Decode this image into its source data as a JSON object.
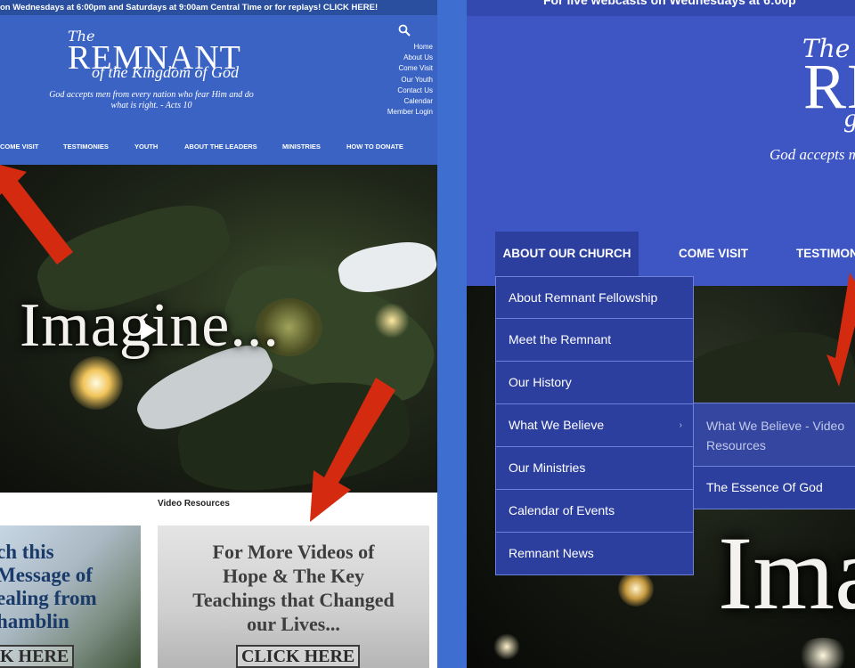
{
  "left": {
    "announcement": "on Wednesdays at 6:00pm and Saturdays at 9:00am Central Time or for replays! CLICK HERE!",
    "logo": {
      "the": "The",
      "name": "REMNANT",
      "sub": "of the Kingdom of God",
      "tagline_1": "God accepts men from every nation who fear Him and do",
      "tagline_2": "what is right.  - Acts 10"
    },
    "util_nav": [
      "Home",
      "About Us",
      "Come Visit",
      "Our Youth",
      "Contact Us",
      "Calendar",
      "Member Login"
    ],
    "main_nav": [
      "COME VISIT",
      "TESTIMONIES",
      "YOUTH",
      "ABOUT THE LEADERS",
      "MINISTRIES",
      "HOW TO DONATE"
    ],
    "hero_text": "Imagine...",
    "video_resources_label": "Video Resources",
    "card1": {
      "lines": [
        "ch this",
        "Message of",
        "ealing from",
        "hamblin"
      ],
      "button": "K HERE"
    },
    "card2": {
      "lines": [
        "For More Videos of",
        "Hope & The Key",
        "Teachings that Changed",
        "our Lives..."
      ],
      "button": "CLICK HERE"
    }
  },
  "right": {
    "announcement": "For live webcasts on Wednesdays at 6:00p",
    "logo": {
      "the": "The",
      "name": "RE",
      "sub": "g",
      "tagline": "God accepts m"
    },
    "main_nav": {
      "active": "ABOUT OUR CHURCH",
      "items": [
        "COME VISIT",
        "TESTIMON"
      ]
    },
    "dropdown": [
      {
        "label": "About Remnant Fellowship",
        "has_submenu": false
      },
      {
        "label": "Meet the Remnant",
        "has_submenu": false
      },
      {
        "label": "Our History",
        "has_submenu": false
      },
      {
        "label": "What We Believe",
        "has_submenu": true
      },
      {
        "label": "Our Ministries",
        "has_submenu": false
      },
      {
        "label": "Calendar of Events",
        "has_submenu": false
      },
      {
        "label": "Remnant News",
        "has_submenu": false
      }
    ],
    "submenu": [
      "What We Believe - Video Resources",
      "The Essence Of God"
    ],
    "submenu_caret": "›",
    "hero_text": "Ima"
  },
  "colors": {
    "header_blue_left": "#3a63c4",
    "header_blue_right": "#3e55c4",
    "menu_blue": "#2c3f9e",
    "arrow_red": "#d42a10"
  }
}
